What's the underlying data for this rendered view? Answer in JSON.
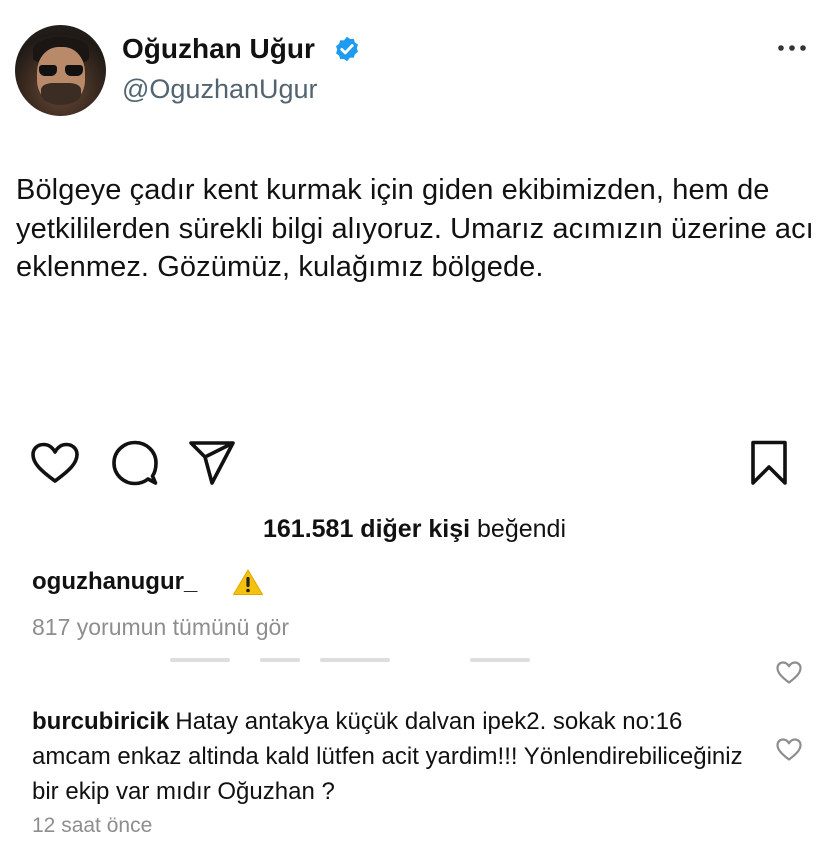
{
  "profile": {
    "display_name": "Oğuzhan Uğur",
    "handle": "@OguzhanUgur",
    "verified_icon": "verified-badge-icon",
    "avatar": "profile-avatar"
  },
  "tweet": {
    "text": "Bölgeye çadır kent kurmak için giden ekibimizden, hem de yetkililerden sürekli bilgi alıyoruz. Umarız acımızın üzerine acı eklenmez. Gözümüz, kulağımız bölgede."
  },
  "actions": {
    "like_icon": "heart-icon",
    "comment_icon": "comment-bubble-icon",
    "share_icon": "paper-plane-icon",
    "save_icon": "bookmark-icon",
    "more_icon": "more-dots-icon"
  },
  "likes": {
    "count_text": "161.581 diğer kişi",
    "suffix": "beğendi"
  },
  "caption": {
    "username": "oguzhanugur_",
    "emoji_icon": "warning-sign-icon"
  },
  "view_all_comments": "817 yorumun tümünü gör",
  "comment": {
    "username": "burcubiricik",
    "text": "Hatay antakya küçük dalvan ipek2. sokak no:16 amcam enkaz altinda kald lütfen acit yardim!!! Yönlendirebiliceğiniz bir ekip var mıdır Oğuzhan ?",
    "time": "12 saat önce"
  },
  "colors": {
    "verified_blue": "#1d9bf0",
    "secondary_text": "#536471",
    "muted_gray": "#8e8e8e",
    "warning_yellow": "#f4c20d"
  }
}
